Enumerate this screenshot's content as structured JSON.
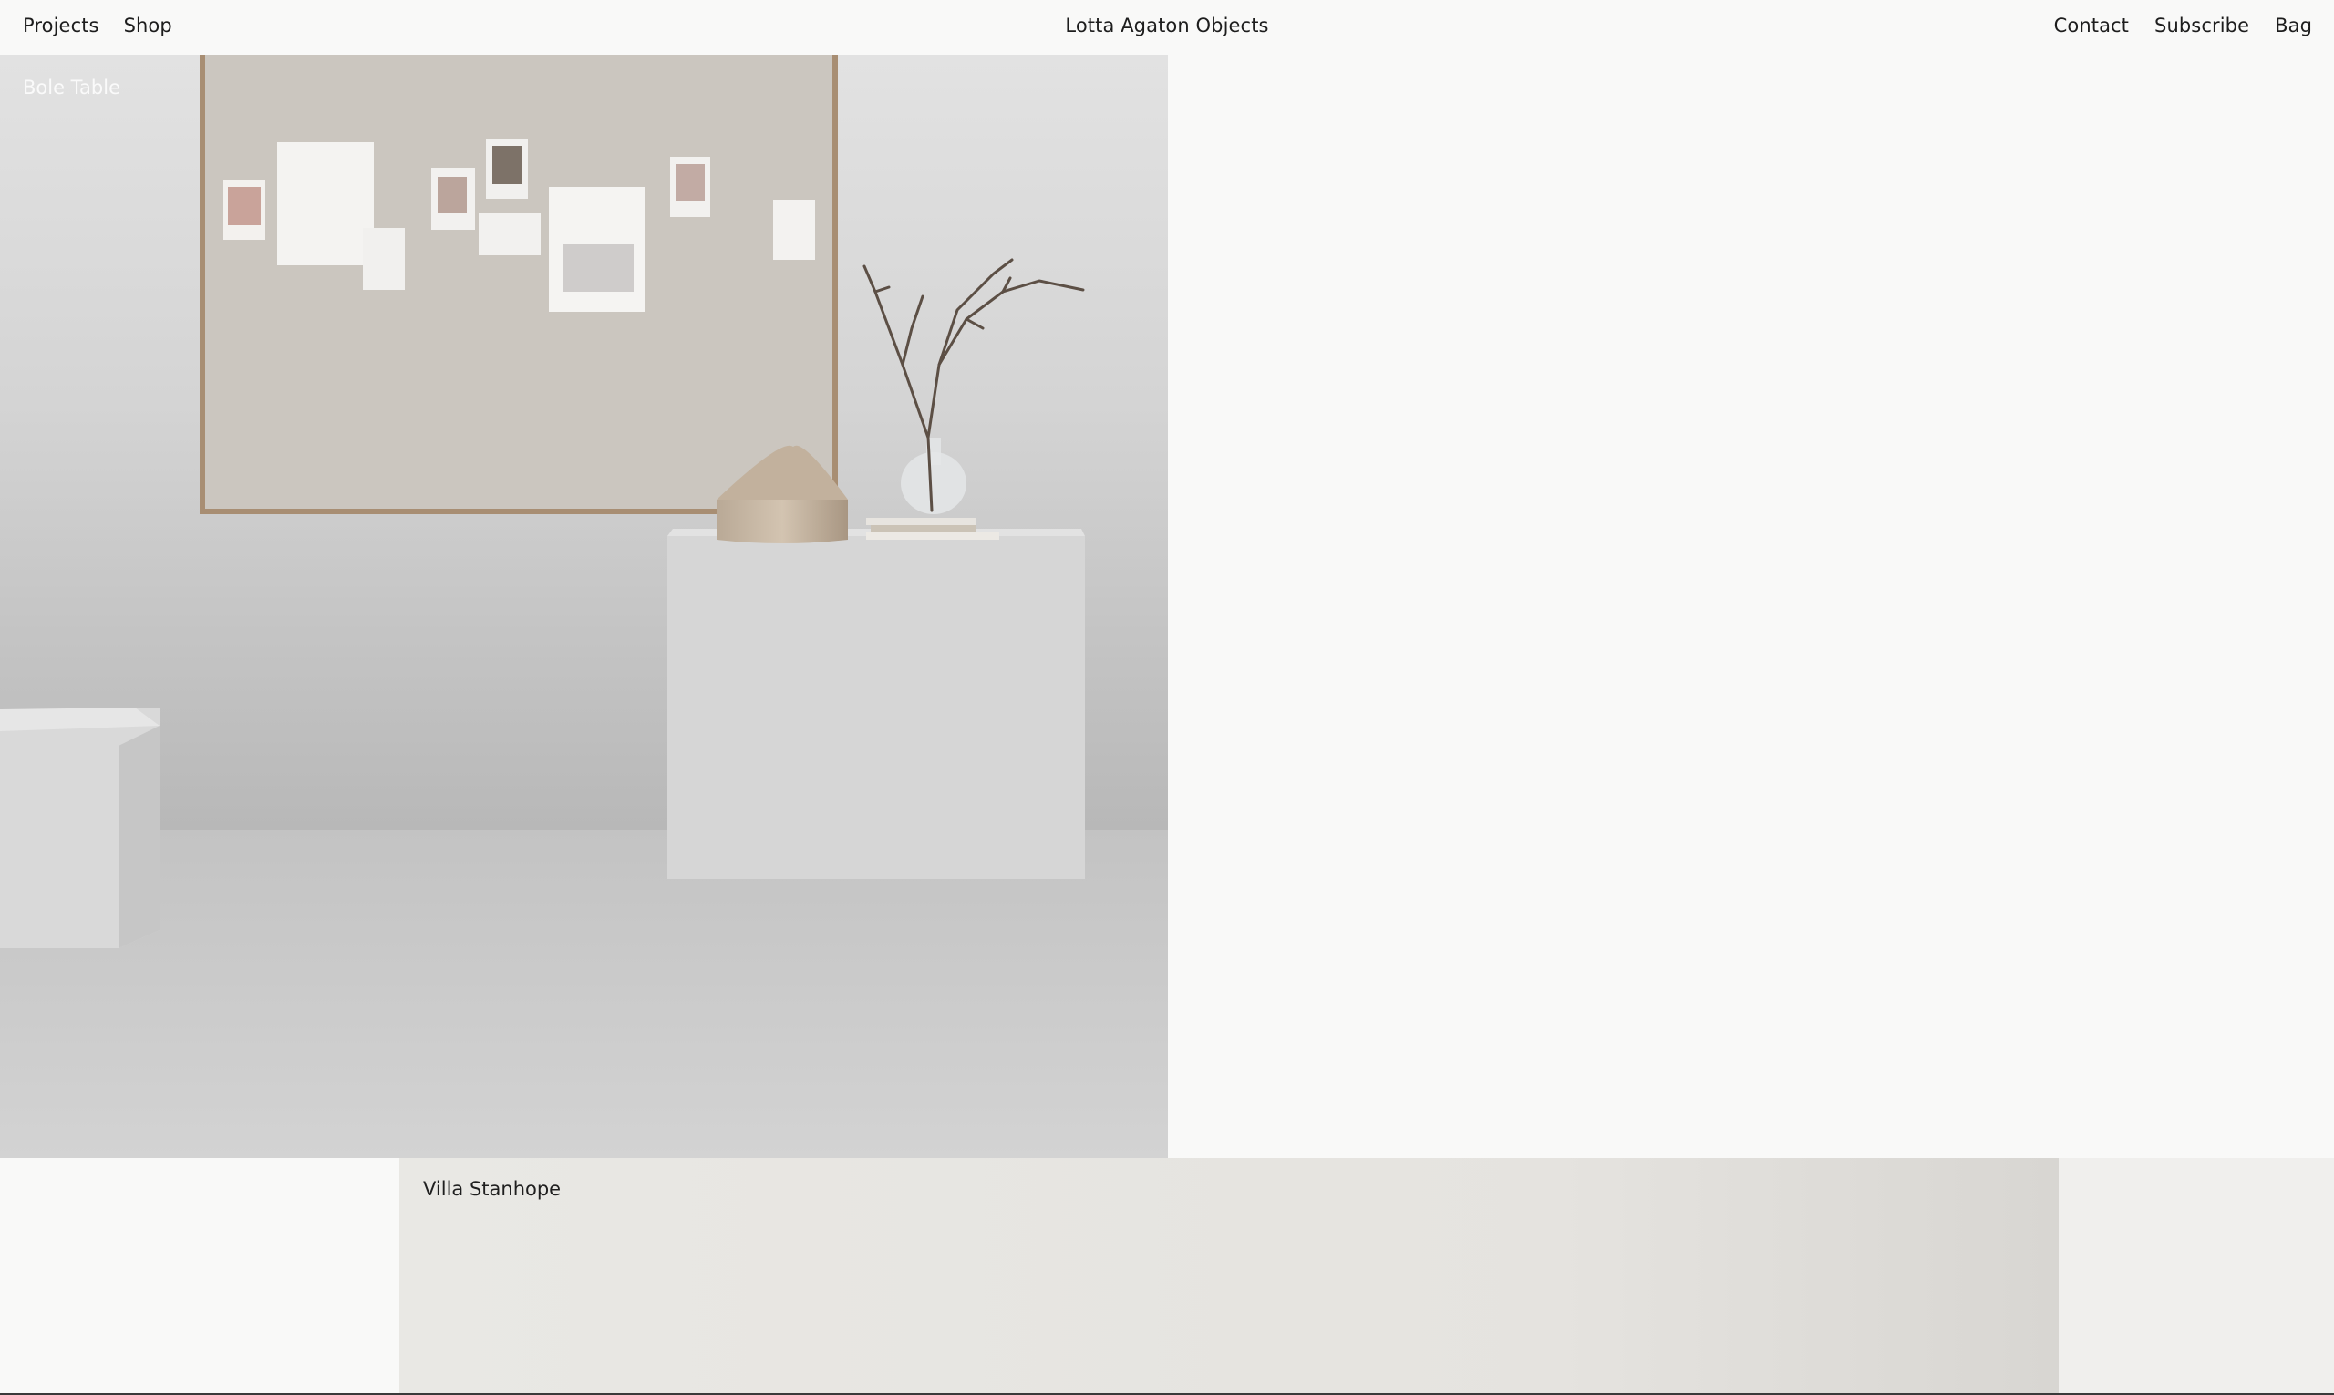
{
  "header": {
    "nav_left": [
      "Projects",
      "Shop"
    ],
    "brand": "Lotta Agaton Objects",
    "nav_right": [
      "Contact",
      "Subscribe",
      "Bag"
    ]
  },
  "projects": [
    {
      "title": "Bole Table"
    },
    {
      "title": "Villa Stanhope"
    }
  ]
}
